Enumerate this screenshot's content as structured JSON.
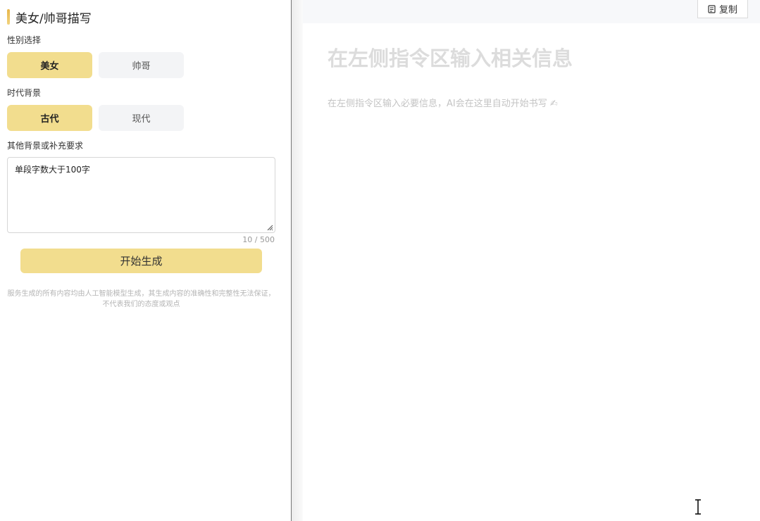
{
  "left": {
    "title": "美女/帅哥描写",
    "gender": {
      "label": "性别选择",
      "options": [
        "美女",
        "帅哥"
      ],
      "selected": "美女"
    },
    "era": {
      "label": "时代背景",
      "options": [
        "古代",
        "现代"
      ],
      "selected": "古代"
    },
    "extra": {
      "label": "其他背景或补充要求",
      "value": "单段字数大于100字",
      "counter": "10 / 500"
    },
    "generate_label": "开始生成",
    "disclaimer": "服务生成的所有内容均由人工智能模型生成，其生成内容的准确性和完整性无法保证，不代表我们的态度或观点"
  },
  "right": {
    "copy_label": "复制",
    "heading": "在左侧指令区输入相关信息",
    "hint": "在左侧指令区输入必要信息，AI会在这里自动开始书写 ✍"
  },
  "colors": {
    "accent": "#f2dd8e",
    "title_bar": "#e8b64a",
    "inactive": "#f3f4f6"
  },
  "icons": {
    "copy": "copy-icon",
    "resize": "resize-grip-icon",
    "cursor": "text-cursor-icon"
  }
}
